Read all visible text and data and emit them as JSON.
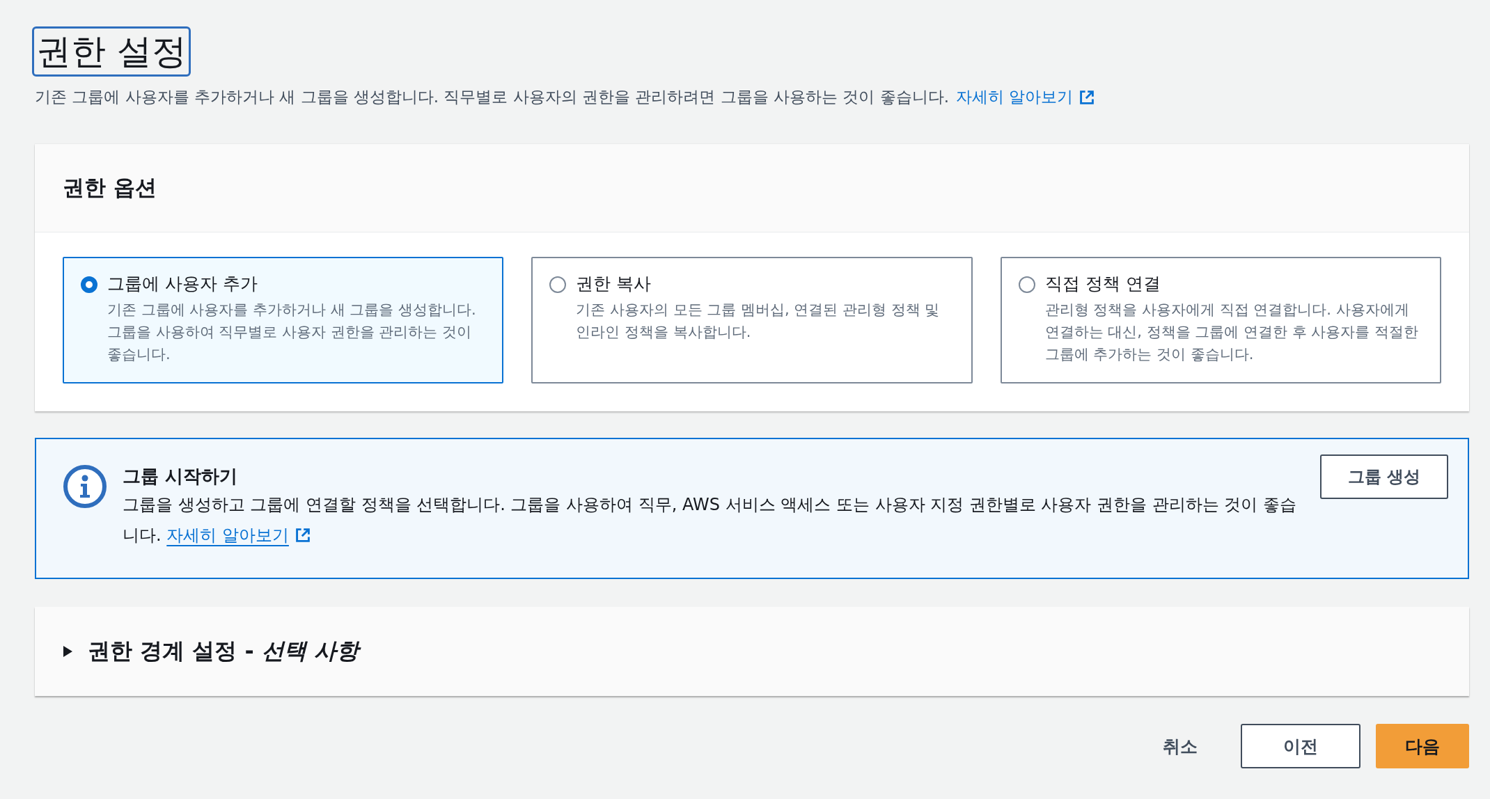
{
  "page": {
    "title": "권한 설정",
    "description": "기존 그룹에 사용자를 추가하거나 새 그룹을 생성합니다. 직무별로 사용자의 권한을 관리하려면 그룹을 사용하는 것이 좋습니다.",
    "learn_more": "자세히 알아보기"
  },
  "permission_options": {
    "title": "권한 옵션",
    "options": [
      {
        "label": "그룹에 사용자 추가",
        "description": "기존 그룹에 사용자를 추가하거나 새 그룹을 생성합니다. 그룹을 사용하여 직무별로 사용자 권한을 관리하는 것이 좋습니다.",
        "selected": true
      },
      {
        "label": "권한 복사",
        "description": "기존 사용자의 모든 그룹 멤버십, 연결된 관리형 정책 및 인라인 정책을 복사합니다.",
        "selected": false
      },
      {
        "label": "직접 정책 연결",
        "description": "관리형 정책을 사용자에게 직접 연결합니다. 사용자에게 연결하는 대신, 정책을 그룹에 연결한 후 사용자를 적절한 그룹에 추가하는 것이 좋습니다.",
        "selected": false
      }
    ]
  },
  "info_alert": {
    "title": "그룹 시작하기",
    "text": "그룹을 생성하고 그룹에 연결할 정책을 선택합니다. 그룹을 사용하여 직무, AWS 서비스 액세스 또는 사용자 지정 권한별로 사용자 권한을 관리하는 것이 좋습니다.",
    "learn_more": "자세히 알아보기",
    "button": "그룹 생성"
  },
  "boundary_section": {
    "title": "권한 경계 설정 - *선택 사항*",
    "expanded": false
  },
  "footer": {
    "cancel": "취소",
    "previous": "이전",
    "next": "다음"
  }
}
